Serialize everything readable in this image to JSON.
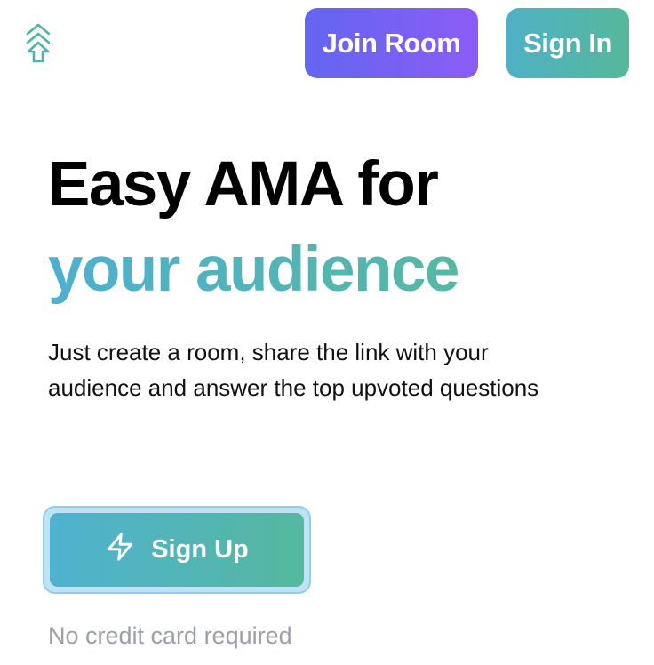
{
  "header": {
    "logo_icon": "double-chevron-arrow-up-icon",
    "join_room_label": "Join Room",
    "sign_in_label": "Sign In"
  },
  "hero": {
    "headline_line1": "Easy AMA for",
    "headline_line2": "your audience",
    "description": "Just create a room, share the link with your audience and answer the top upvoted questions",
    "signup_icon": "lightning-bolt-icon",
    "signup_label": "Sign Up",
    "note": "No credit card required"
  },
  "colors": {
    "join_gradient": [
      "#6366f1",
      "#8b5cf6"
    ],
    "teal_gradient": [
      "#4fb0c6",
      "#55b89a"
    ],
    "note_gray": "#9aa0a8"
  }
}
